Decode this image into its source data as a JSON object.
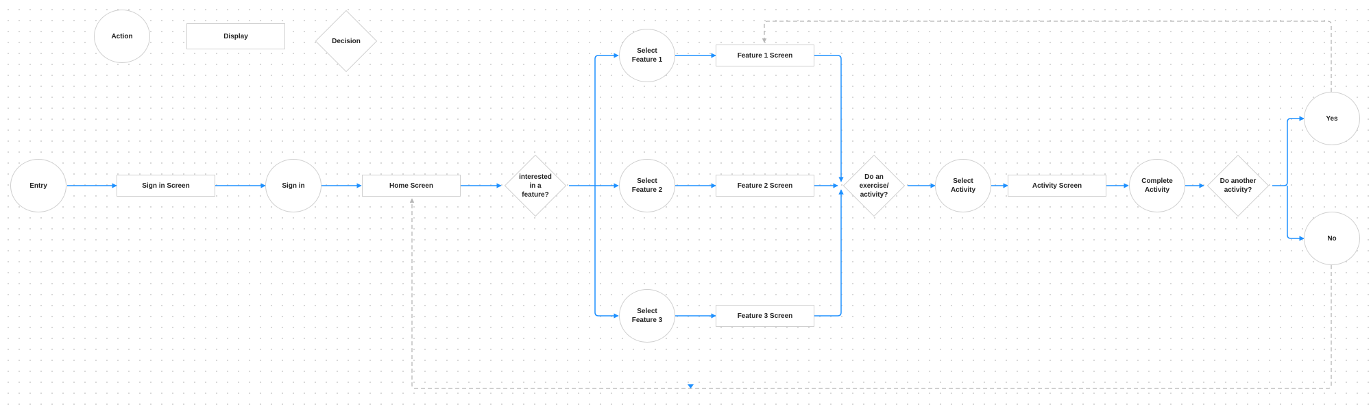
{
  "legend": {
    "action": "Action",
    "display": "Display",
    "decision": "Decision"
  },
  "nodes": {
    "entry": "Entry",
    "sign_in_screen": "Sign in Screen",
    "sign_in": "Sign in",
    "home_screen": "Home Screen",
    "interested_decision": "interested\nin a\nfeature?",
    "select_feature_1": "Select\nFeature 1",
    "select_feature_2": "Select\nFeature 2",
    "select_feature_3": "Select\nFeature 3",
    "feature_1_screen": "Feature 1 Screen",
    "feature_2_screen": "Feature 2 Screen",
    "feature_3_screen": "Feature 3 Screen",
    "exercise_decision": "Do an\nexercise/\nactivity?",
    "select_activity": "Select\nActivity",
    "activity_screen": "Activity Screen",
    "complete_activity": "Complete\nActivity",
    "another_decision": "Do another\nactivity?",
    "yes": "Yes",
    "no": "No"
  },
  "colors": {
    "flow_line": "#1e90ff",
    "loop_line": "#b5b5b5",
    "shape_border": "#cfcfcf",
    "text": "#222222",
    "background": "#ffffff"
  }
}
